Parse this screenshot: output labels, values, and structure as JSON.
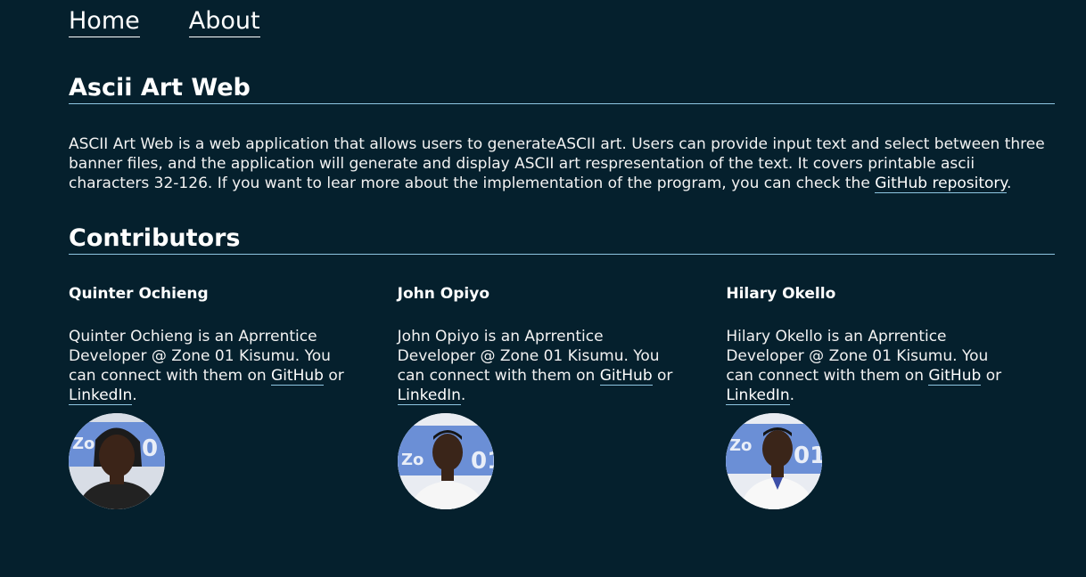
{
  "nav": {
    "home": "Home",
    "about": "About"
  },
  "intro": {
    "title": "Ascii Art Web",
    "text_before": "ASCII Art Web is a web application that allows users to generateASCII art. Users can provide input text and select between three banner files, and the application will generate and display ASCII art respresentation of the text. It covers printable ascii characters 32-126. If you want to lear more about the implementation of the program, you can check the ",
    "link": "GitHub repository",
    "text_after": "."
  },
  "contributors": {
    "title": "Contributors",
    "people": [
      {
        "name": "Quinter Ochieng",
        "bio": "Quinter Ochieng is an Aprrentice Developer @ Zone 01 Kisumu. You can connect with them on ",
        "github": "GitHub",
        "or": " or ",
        "linkedin": "LinkedIn",
        "end": "."
      },
      {
        "name": "John Opiyo",
        "bio": "John Opiyo is an Aprrentice Developer @ Zone 01 Kisumu. You can connect with them on ",
        "github": "GitHub",
        "or": " or ",
        "linkedin": "LinkedIn",
        "end": "."
      },
      {
        "name": "Hilary Okello",
        "bio": "Hilary Okello is an Aprrentice Developer @ Zone 01 Kisumu. You can connect with them on ",
        "github": "GitHub",
        "or": " or ",
        "linkedin": "LinkedIn",
        "end": "."
      }
    ]
  },
  "colors": {
    "background": "#05202d",
    "accent_underline": "#8ec6e2",
    "banner_blue": "#6b8fd6"
  }
}
